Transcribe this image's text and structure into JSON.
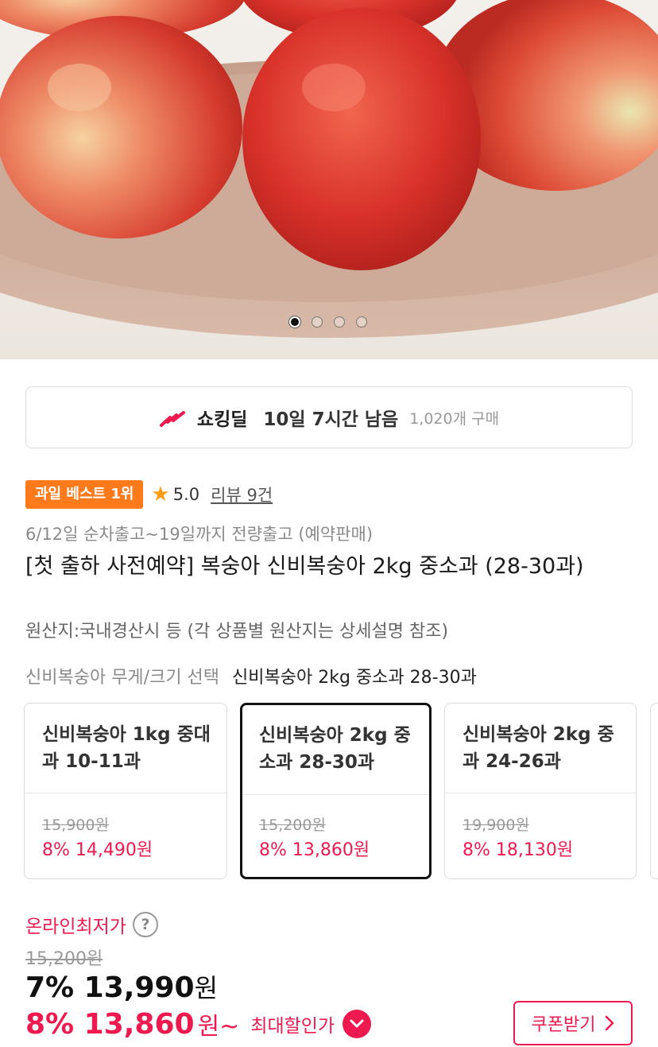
{
  "hero": {
    "image_desc": "",
    "total_slides": 4,
    "active_slide": 1
  },
  "deal": {
    "icon": "lightning-icon",
    "brand": "쇼킹딜",
    "remaining": "10일 7시간 남음",
    "sold": "1,020개 구매"
  },
  "product": {
    "badge": "과일 베스트 1위",
    "rating": "5.0",
    "review": "리뷰 9건",
    "shipping": "6/12일 순차출고~19일까지 전량출고 (예약판매)",
    "title": "[첫 출하 사전예약] 복숭아 신비복숭아 2kg 중소과 (28-30과)",
    "origin": "원산지:국내경산시 등 (각 상품별 원산지는 상세설명 참조)"
  },
  "options": {
    "label": "신비복숭아 무게/크기 선택",
    "selected_value": "신비복숭아  2kg 중소과 28-30과",
    "cards": [
      {
        "name": "신비복숭아 1kg 중대과 10-11과",
        "original": "15,900원",
        "sale": "8% 14,490원",
        "selected": false
      },
      {
        "name": "신비복숭아  2kg 중소과 28-30과",
        "original": "15,200원",
        "sale": "8% 13,860원",
        "selected": true
      },
      {
        "name": "신비복숭아  2kg 중과 24-26과",
        "original": "19,900원",
        "sale": "8% 18,130원",
        "selected": false
      }
    ]
  },
  "price": {
    "lowest_label": "온라인최저가",
    "help_icon": "?",
    "original": "15,200원",
    "current_rate": "7%",
    "current_amount": "13,990",
    "current_unit": "원",
    "max_rate_amount": "8% 13,860",
    "max_unit": "원~",
    "max_label": "최대할인가",
    "coupon_button": "쿠폰받기"
  },
  "colors": {
    "accent": "#ee1a4f",
    "badge": "#ff7a1a",
    "star": "#ff9d1a"
  }
}
